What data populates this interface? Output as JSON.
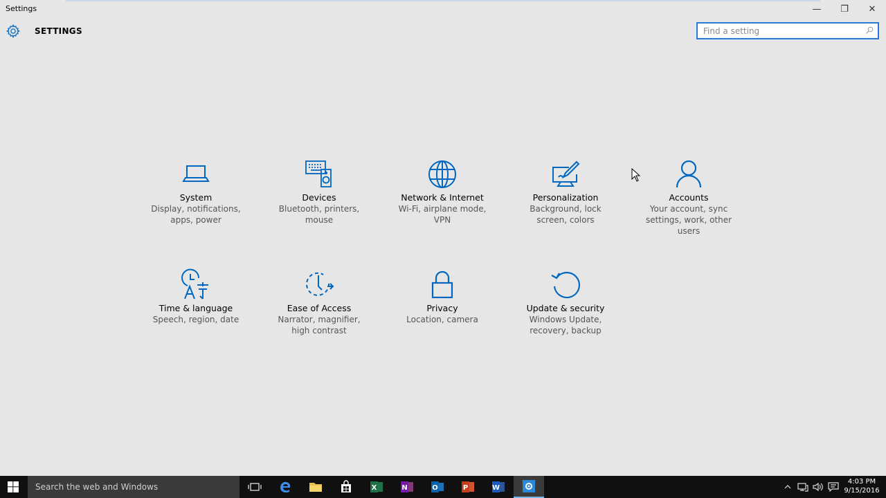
{
  "window": {
    "title": "Settings",
    "minimize_label": "—",
    "maximize_label": "❐",
    "close_label": "✕"
  },
  "header": {
    "icon": "gear-icon",
    "title": "SETTINGS"
  },
  "search": {
    "placeholder": "Find a setting",
    "value": ""
  },
  "accent_color": "#0067c0",
  "categories": [
    {
      "name": "System",
      "description": "Display, notifications, apps, power",
      "icon": "laptop-icon"
    },
    {
      "name": "Devices",
      "description": "Bluetooth, printers, mouse",
      "icon": "devices-icon"
    },
    {
      "name": "Network & Internet",
      "description": "Wi-Fi, airplane mode, VPN",
      "icon": "globe-icon"
    },
    {
      "name": "Personalization",
      "description": "Background, lock screen, colors",
      "icon": "paint-brush-icon"
    },
    {
      "name": "Accounts",
      "description": "Your account, sync settings, work, other users",
      "icon": "person-icon"
    },
    {
      "name": "Time & language",
      "description": "Speech, region, date",
      "icon": "time-language-icon"
    },
    {
      "name": "Ease of Access",
      "description": "Narrator, magnifier, high contrast",
      "icon": "ease-of-access-icon"
    },
    {
      "name": "Privacy",
      "description": "Location, camera",
      "icon": "lock-icon"
    },
    {
      "name": "Update & security",
      "description": "Windows Update, recovery, backup",
      "icon": "refresh-icon"
    }
  ],
  "taskbar": {
    "search_placeholder": "Search the web and Windows",
    "apps": [
      "task-view-icon",
      "edge-icon",
      "file-explorer-icon",
      "store-icon",
      "excel-icon",
      "onenote-icon",
      "outlook-icon",
      "powerpoint-icon",
      "word-icon",
      "settings-icon"
    ],
    "clock_time": "4:03 PM",
    "clock_date": "9/15/2016"
  }
}
